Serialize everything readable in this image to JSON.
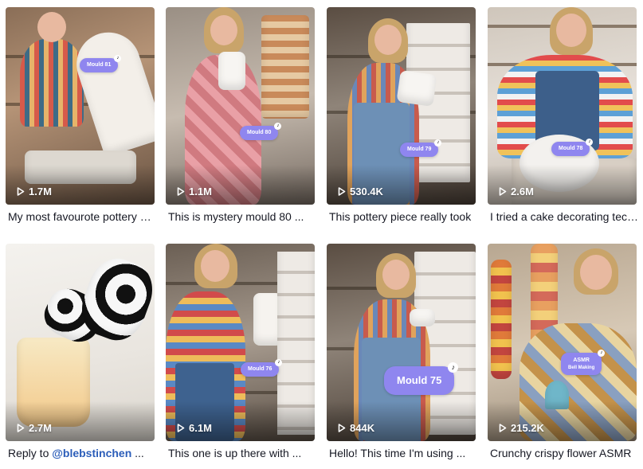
{
  "videos": [
    {
      "views": "1.7M",
      "caption": "My most favourote pottery piece",
      "tag": "Mould 81"
    },
    {
      "views": "1.1M",
      "caption": "This is mystery mould 80 ...",
      "tag": "Mould 80"
    },
    {
      "views": "530.4K",
      "caption": "This pottery piece really took",
      "tag": "Mould 79"
    },
    {
      "views": "2.6M",
      "caption": "I tried a cake decorating technique",
      "tag": "Mould 78"
    },
    {
      "views": "2.7M",
      "caption_prefix": "Reply to ",
      "mention": "@blebstinchen",
      "caption_suffix": " ..."
    },
    {
      "views": "6.1M",
      "caption": "This one is up there with ...",
      "tag": "Mould 76"
    },
    {
      "views": "844K",
      "caption": "Hello! This time I'm using ...",
      "tag": "Mould 75"
    },
    {
      "views": "215.2K",
      "caption": "Crunchy crispy flower ASMR",
      "tag_line1": "ASMR",
      "tag_line2": "Bell Making"
    }
  ],
  "icons": {
    "play": "play-icon",
    "tiktok": "tiktok-icon"
  },
  "colors": {
    "tag": "#8f86ef",
    "mention": "#2b5db9",
    "caption": "#161823"
  }
}
